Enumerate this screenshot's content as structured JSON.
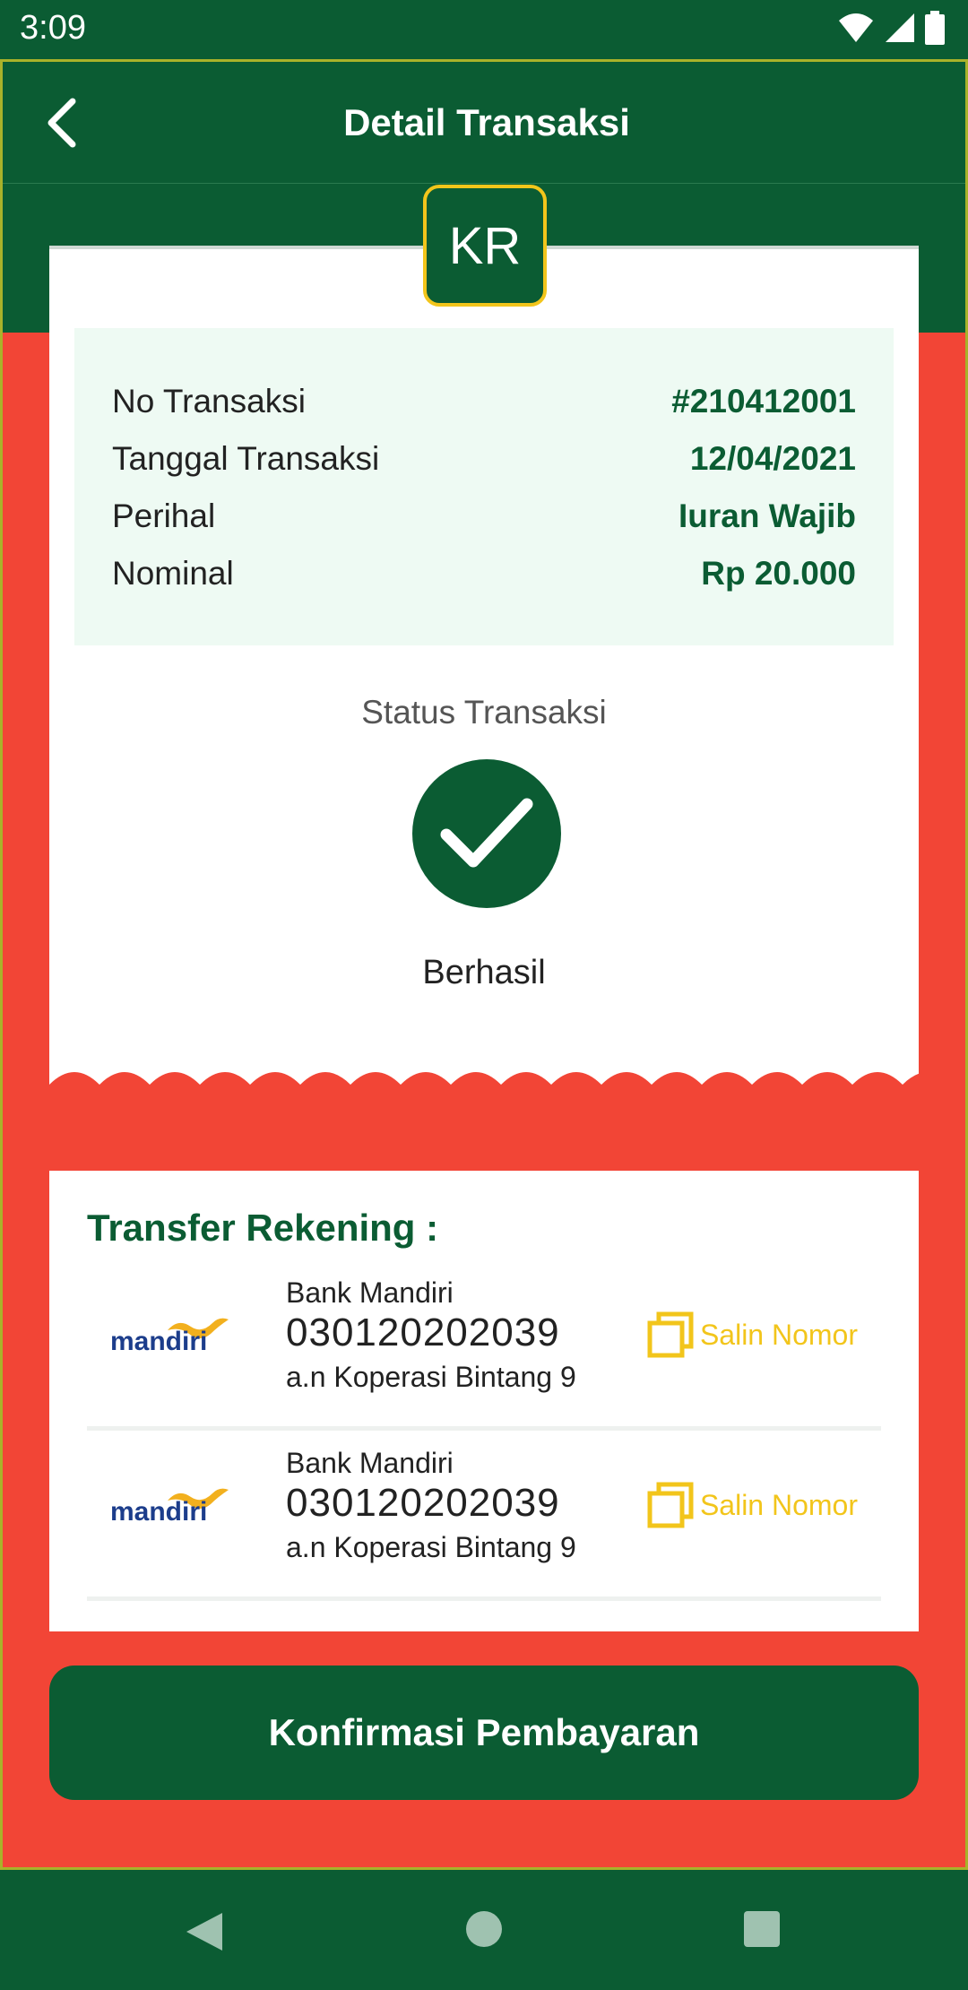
{
  "status_bar": {
    "time": "3:09"
  },
  "app_bar": {
    "title": "Detail Transaksi"
  },
  "receipt": {
    "badge": "KR",
    "rows": [
      {
        "label": "No Transaksi",
        "value": "#210412001"
      },
      {
        "label": "Tanggal Transaksi",
        "value": "12/04/2021"
      },
      {
        "label": "Perihal",
        "value": "Iuran Wajib"
      },
      {
        "label": "Nominal",
        "value": "Rp 20.000"
      }
    ],
    "status_title": "Status Transaksi",
    "status_text": "Berhasil"
  },
  "transfer": {
    "title": "Transfer Rekening :",
    "accounts": [
      {
        "logo_text": "mandiri",
        "bank": "Bank Mandiri",
        "number": "030120202039",
        "owner": "a.n Koperasi Bintang 9",
        "copy_label": "Salin Nomor"
      },
      {
        "logo_text": "mandiri",
        "bank": "Bank Mandiri",
        "number": "030120202039",
        "owner": "a.n Koperasi Bintang 9",
        "copy_label": "Salin Nomor"
      }
    ]
  },
  "confirm_button": "Konfirmasi Pembayaran",
  "colors": {
    "primary": "#0b5c33",
    "accent": "#f2c51b",
    "background": "#f24536",
    "info_bg": "#eefaf3"
  }
}
